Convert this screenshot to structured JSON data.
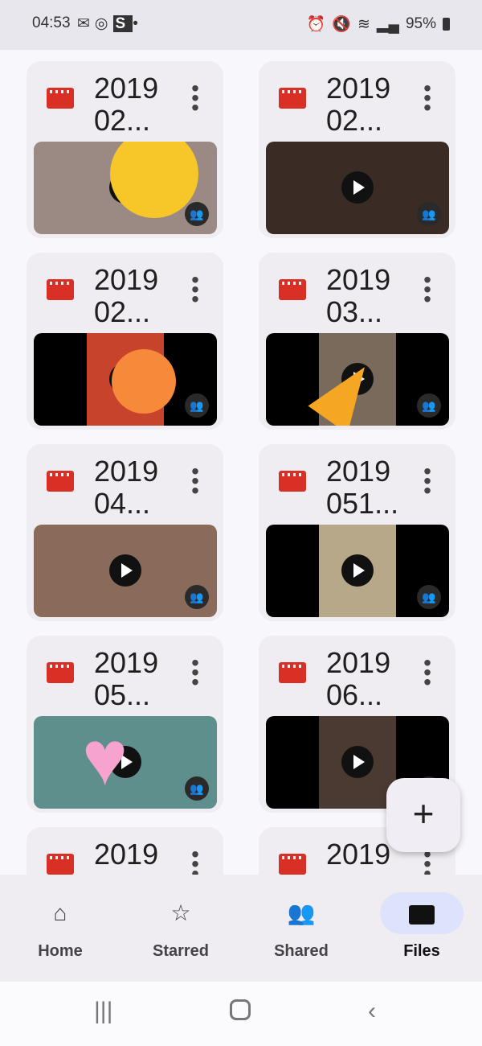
{
  "status_bar": {
    "time": "04:53",
    "left_icons": [
      "voicemail-icon",
      "instagram-icon",
      "s-icon",
      "dot-icon"
    ],
    "right_icons": [
      "alarm-icon",
      "mute-icon",
      "wifi-icon",
      "wifi-call-icon",
      "signal-icon"
    ],
    "battery": "95%"
  },
  "files": [
    {
      "name": "2019 02...",
      "thumb": "#9b8a84",
      "bars": false,
      "sticker": "moon"
    },
    {
      "name": "2019 02...",
      "thumb": "#3a2c25",
      "bars": false,
      "sticker": ""
    },
    {
      "name": "2019 02...",
      "thumb": "#c8432c",
      "bars": true,
      "sticker": "sun"
    },
    {
      "name": "2019 03...",
      "thumb": "#7a6a5c",
      "bars": true,
      "sticker": "party"
    },
    {
      "name": "2019 04...",
      "thumb": "#8a6a5a",
      "bars": false,
      "sticker": ""
    },
    {
      "name": "2019 051...",
      "thumb": "#b8a88a",
      "bars": true,
      "sticker": ""
    },
    {
      "name": "2019 05...",
      "thumb": "#5e8f8c",
      "bars": false,
      "sticker": "heart"
    },
    {
      "name": "2019 06...",
      "thumb": "#4a3a32",
      "bars": true,
      "sticker": ""
    },
    {
      "name": "2019",
      "thumb": "#777",
      "bars": false,
      "sticker": ""
    },
    {
      "name": "2019",
      "thumb": "#777",
      "bars": false,
      "sticker": ""
    }
  ],
  "fab": {
    "label": "+"
  },
  "nav": [
    {
      "label": "Home",
      "icon": "home-icon"
    },
    {
      "label": "Starred",
      "icon": "star-icon"
    },
    {
      "label": "Shared",
      "icon": "people-icon"
    },
    {
      "label": "Files",
      "icon": "folder-icon",
      "active": true
    }
  ],
  "system_nav": [
    "recent-apps-icon",
    "home-icon",
    "back-icon"
  ],
  "colors": {
    "accent": "#dce3fb",
    "file_icon": "#d93025"
  }
}
